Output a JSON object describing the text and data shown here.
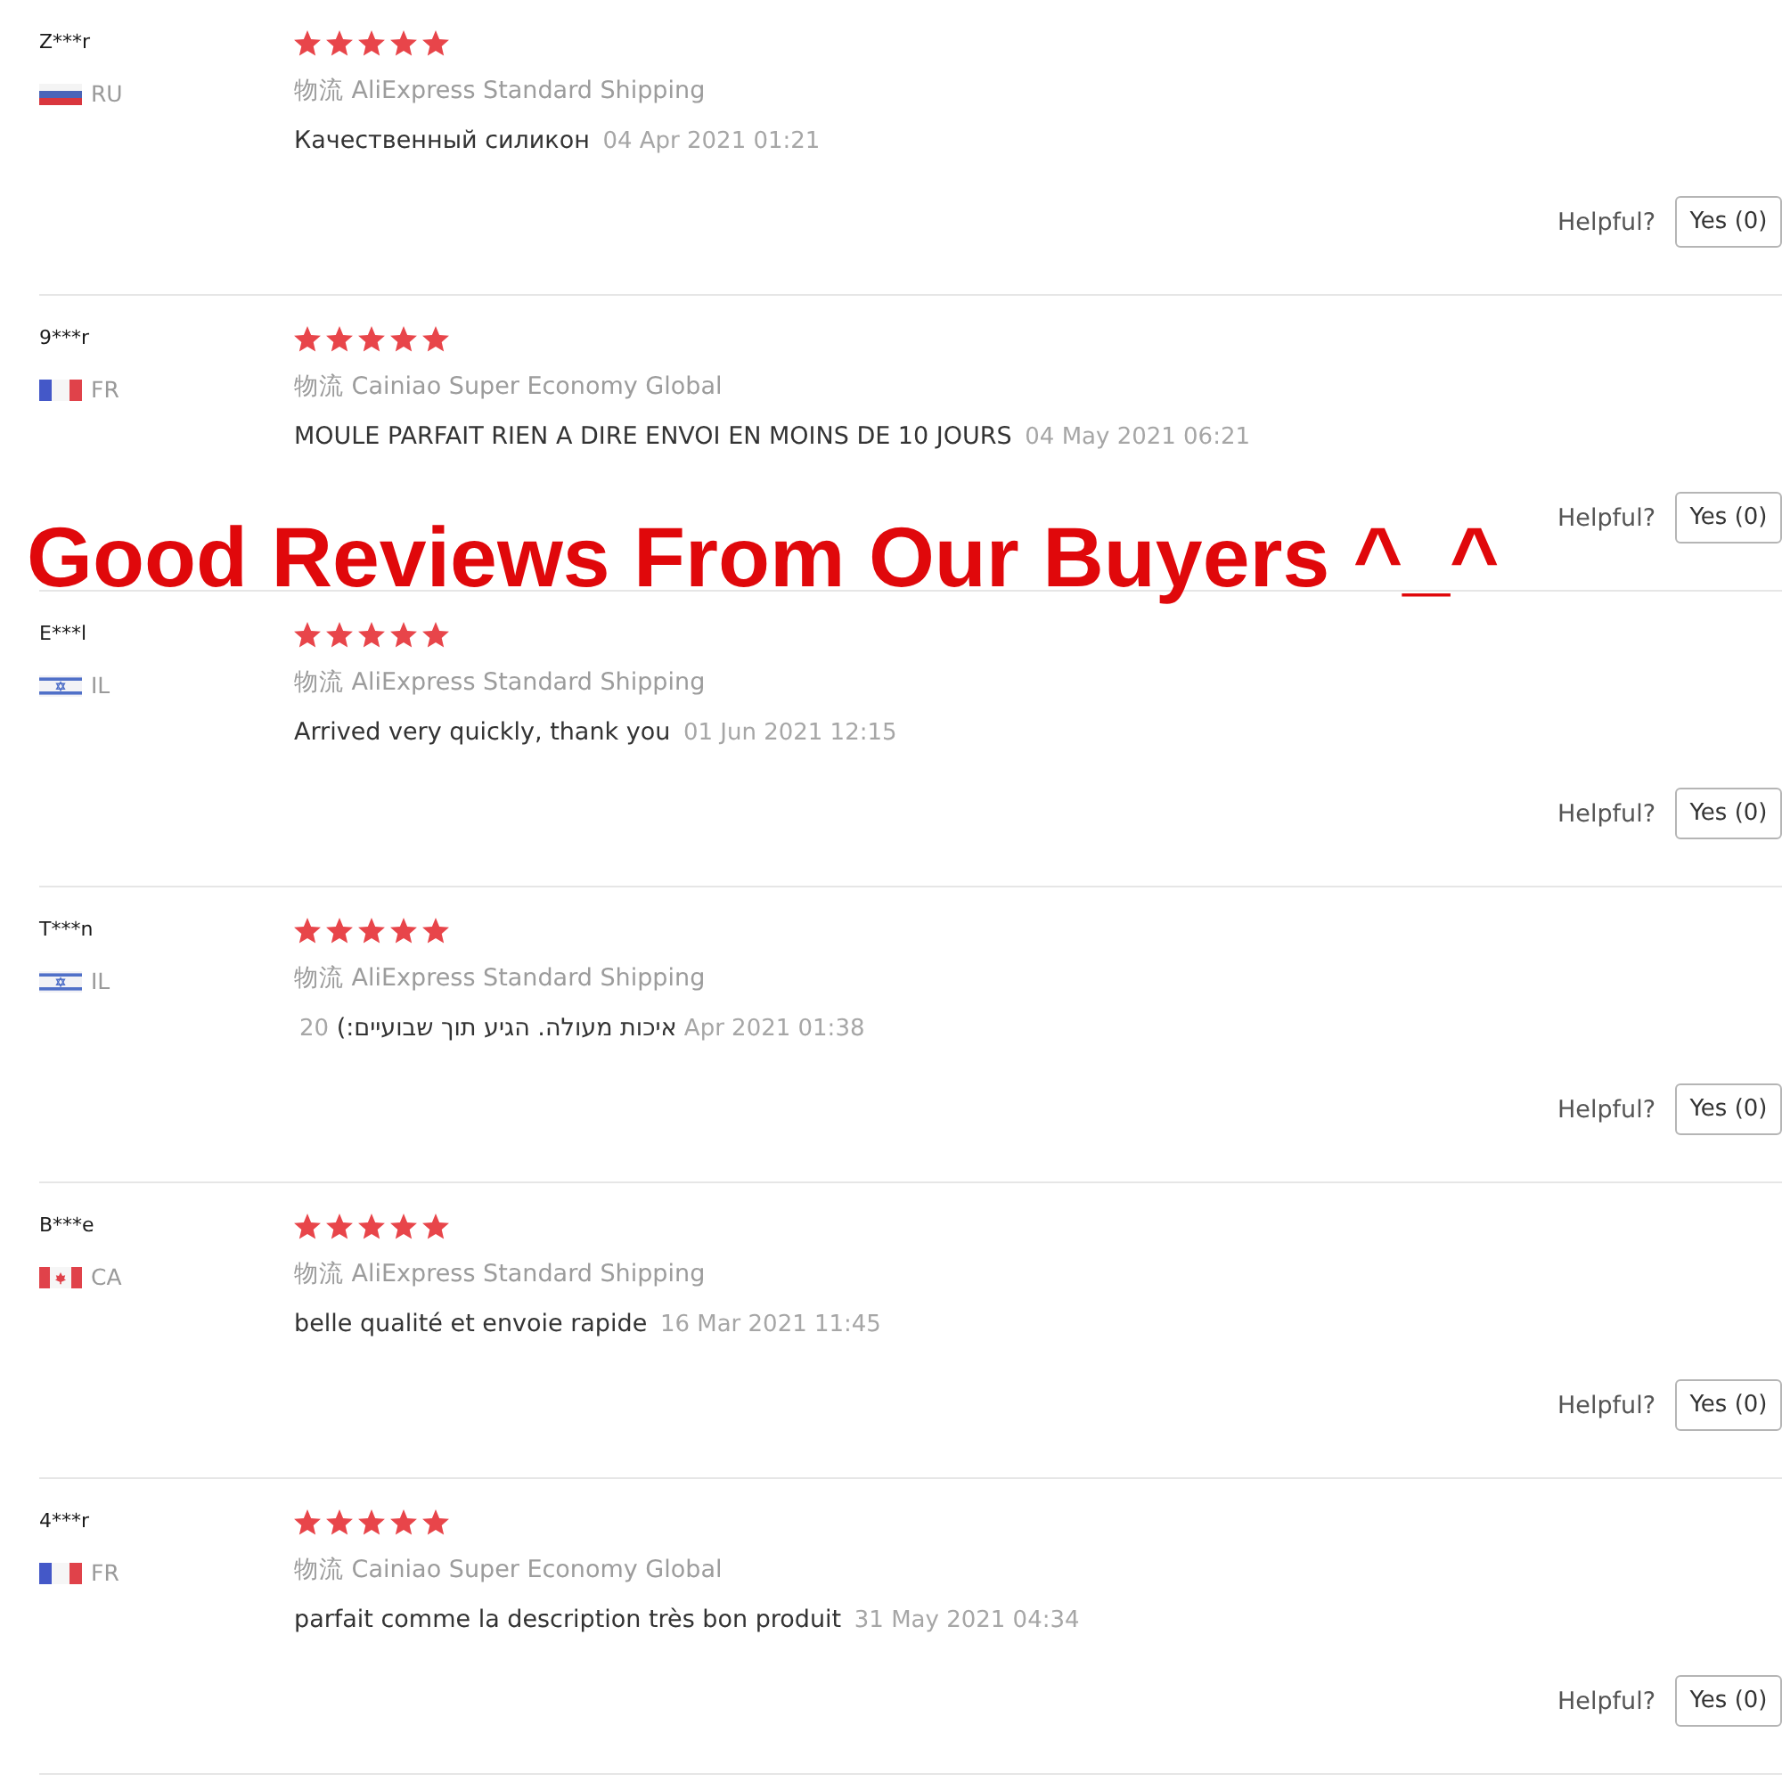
{
  "reviews": [
    {
      "name": "Z***r",
      "country": "RU",
      "flag": {
        "kind": "russia"
      },
      "stars": 5,
      "shipping": "物流 AliExpress Standard Shipping",
      "comment": "Качественный силикон",
      "date": "04 Apr 2021 01:21",
      "helpful_label": "Helpful?",
      "helpful_button": "Yes (0)"
    },
    {
      "name": "9***r",
      "country": "FR",
      "flag": {
        "kind": "france"
      },
      "stars": 5,
      "shipping": "物流 Cainiao Super Economy Global",
      "comment": "MOULE PARFAIT RIEN A DIRE ENVOI EN MOINS DE 10 JOURS",
      "date": "04 May 2021 06:21",
      "helpful_label": "Helpful?",
      "helpful_button": "Yes (0)"
    },
    {
      "name": "E***l",
      "country": "IL",
      "flag": {
        "kind": "israel"
      },
      "stars": 5,
      "shipping": "物流 AliExpress Standard Shipping",
      "comment": "Arrived very quickly, thank you",
      "date": "01 Jun 2021 12:15",
      "helpful_label": "Helpful?",
      "helpful_button": "Yes (0)"
    },
    {
      "name": "T***n",
      "country": "IL",
      "flag": {
        "kind": "israel"
      },
      "stars": 5,
      "shipping": "物流 AliExpress Standard Shipping",
      "comment": "איכות מעולה. הגיע תוך שבועיים:)",
      "date": "20 Apr 2021 01:38",
      "helpful_label": "Helpful?",
      "helpful_button": "Yes (0)"
    },
    {
      "name": "B***e",
      "country": "CA",
      "flag": {
        "kind": "canada"
      },
      "stars": 5,
      "shipping": "物流 AliExpress Standard Shipping",
      "comment": "belle qualité et envoie rapide",
      "date": "16 Mar 2021 11:45",
      "helpful_label": "Helpful?",
      "helpful_button": "Yes (0)"
    },
    {
      "name": "4***r",
      "country": "FR",
      "flag": {
        "kind": "france"
      },
      "stars": 5,
      "shipping": "物流 Cainiao Super Economy Global",
      "comment": "parfait comme la description très bon produit",
      "date": "31 May 2021 04:34",
      "helpful_label": "Helpful?",
      "helpful_button": "Yes (0)"
    }
  ],
  "overlay_caption": "Good Reviews From Our Buyers ^_^"
}
